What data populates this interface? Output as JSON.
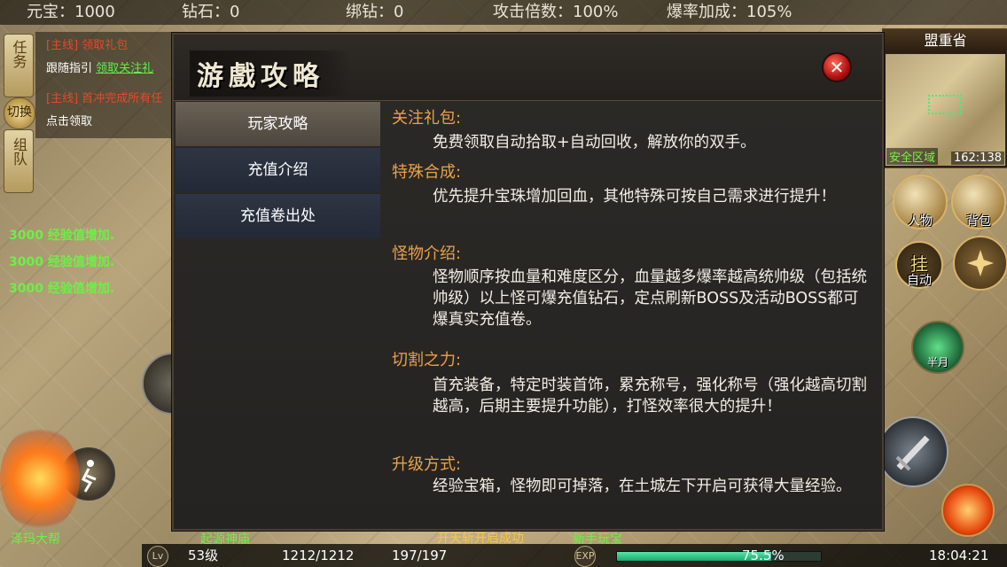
{
  "topbar": {
    "yuanbao": "元宝：1000",
    "diamond": "钻石：0",
    "bound_diamond": "绑钻：0",
    "attack_mult": "攻击倍数：100%",
    "drop_bonus": "爆率加成：105%"
  },
  "quest": {
    "tab_task": "任务",
    "tab_switch": "切换",
    "tab_team": "组队",
    "line1_tag": "[主线]",
    "line1_text": "领取礼包",
    "line2_label": "跟随指引",
    "line2_link": "领取关注礼",
    "line3_tag": "[主线]",
    "line3_text": "首冲完成所有任",
    "line4": "点击领取"
  },
  "exp_log": [
    "3000 经验值增加.",
    "3000 经验值增加.",
    "3000 经验值增加."
  ],
  "minimap": {
    "title": "盟重省",
    "safe_zone": "安全区域",
    "coords": "162:138"
  },
  "right_buttons": {
    "character": "人物",
    "bag": "背包",
    "auto": "自动",
    "auto_glyph": "挂",
    "half_moon": "半月"
  },
  "dialog": {
    "title": "游戲攻略",
    "close": "✕",
    "menu": [
      "玩家攻略",
      "充值介绍",
      "充值卷出处"
    ],
    "active_index": 0,
    "sections": [
      {
        "heading": "关注礼包:",
        "body": "免费领取自动拾取+自动回收，解放你的双手。"
      },
      {
        "heading": "特殊合成:",
        "body": "优先提升宝珠增加回血，其他特殊可按自己需求进行提升！"
      },
      {
        "heading": "怪物介绍:",
        "body": "怪物顺序按血量和难度区分，血量越多爆率越高统帅级（包括统帅级）以上怪可爆充值钻石，定点刷新BOSS及活动BOSS都可爆真实充值卷。"
      },
      {
        "heading": "切割之力:",
        "body": "首充装备，特定时装首饰，累充称号，强化称号（强化越高切割越高，后期主要提升功能），打怪效率很大的提升！"
      },
      {
        "heading": "升级方式:",
        "body": "经验宝箱，怪物即可掉落，在土城左下开启可获得大量经验。"
      }
    ]
  },
  "bottom": {
    "lv_badge": "Lv",
    "level": "53级",
    "hp": "1212/1212",
    "mp": "197/197",
    "exp_badge": "EXP",
    "exp_percent": "75.5%",
    "exp_fill": 0.755,
    "time": "18:04:21",
    "notice": "开天斩开启成功",
    "name_left1": "泽玛大帮",
    "name_left2": "起源神庙",
    "name_right": "新手玩宝"
  },
  "colors": {
    "accent_orange": "#e9a24b",
    "exp_green": "#6cf046",
    "active_menu": "#5b5449",
    "menu_bg": "#2a303d"
  }
}
